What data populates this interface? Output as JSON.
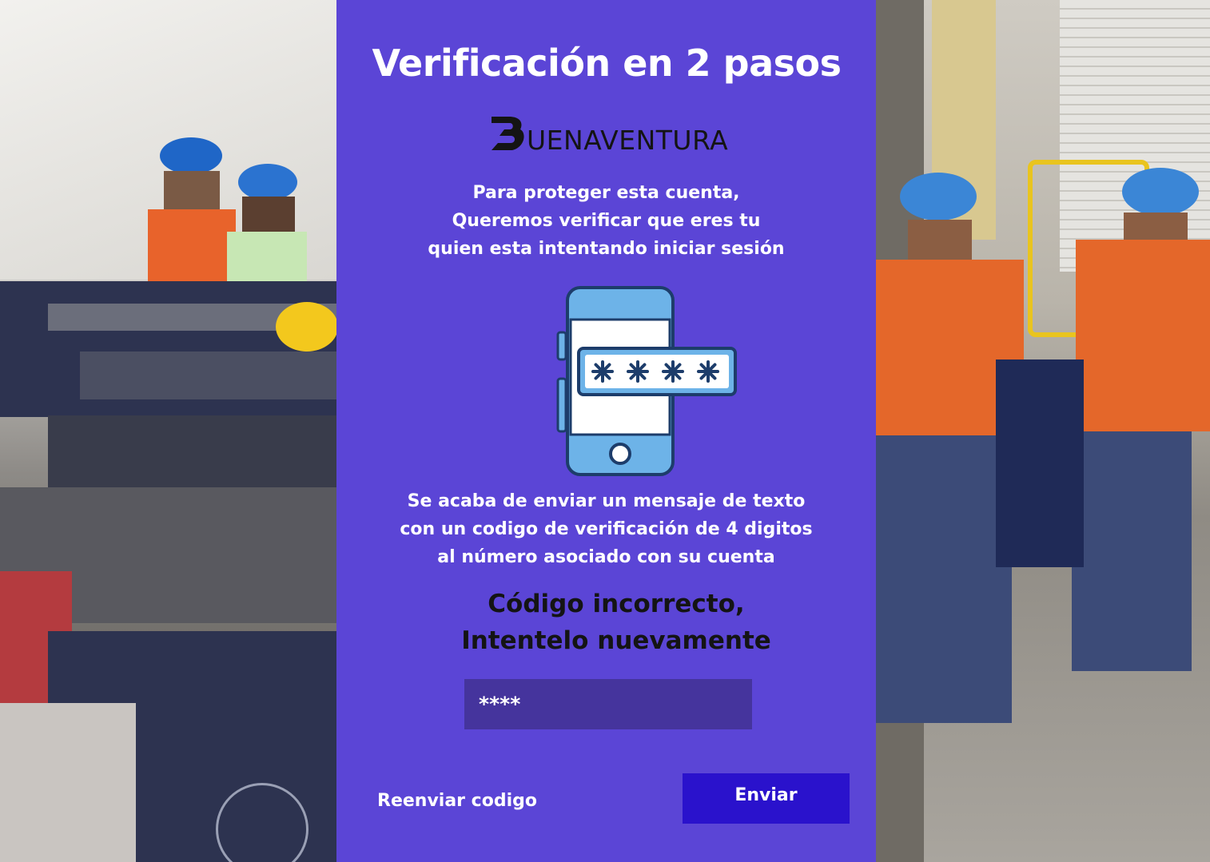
{
  "header": {
    "title": "Verificación en 2 pasos"
  },
  "brand": {
    "logo_text": "UENAVENTURA",
    "logo_initial": "B"
  },
  "intro": {
    "lines": [
      "Para proteger esta cuenta,",
      "Queremos verificar que eres tu",
      "quien esta intentando iniciar sesión"
    ]
  },
  "illustration": {
    "icon": "phone-password-icon",
    "masked_code": "****"
  },
  "message": {
    "lines": [
      "Se acaba de enviar un mensaje de texto",
      "con un codigo de verificación de 4 digitos",
      "al número asociado con su cuenta"
    ]
  },
  "error": {
    "lines": [
      "Código incorrecto,",
      "Intentelo nuevamente"
    ]
  },
  "form": {
    "code_value": "****"
  },
  "actions": {
    "resend_label": "Reenviar codigo",
    "send_label": "Enviar"
  },
  "colors": {
    "panel_bg": "#5b45d6",
    "input_bg": "#45349d",
    "button_bg": "#2a12cc",
    "phone_fill": "#6db3e8",
    "phone_stroke": "#1d3d6b"
  }
}
